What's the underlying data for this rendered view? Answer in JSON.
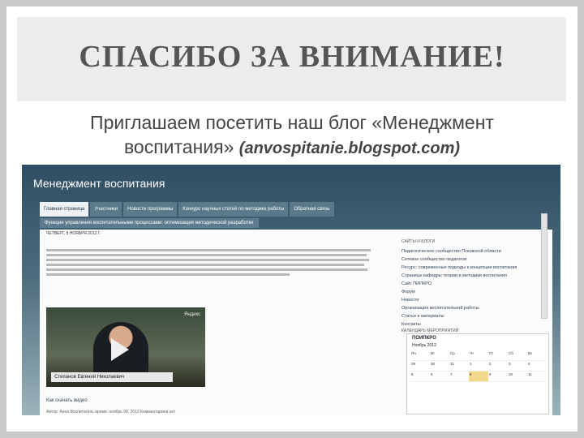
{
  "slide": {
    "title": "СПАСИБО ЗА ВНИМАНИЕ!",
    "subtitle_line1": "Приглашаем посетить наш блог «Менеджмент",
    "subtitle_line2": "воспитания»",
    "subtitle_url": "(anvospitanie.blogspot.com)"
  },
  "blog": {
    "name": "Менеджмент воспитания",
    "tabs": [
      "Главная страница",
      "Участники",
      "Новости программы",
      "Конкурс научных статей по методике работы",
      "Обратная связь"
    ],
    "tab_row2": "Функции управления воспитательными процессами: оптимизация методической разработки",
    "post": {
      "date": "ЧЕТВЕРГ, 8 НОЯБРЯ 2012 Г.",
      "title": "Ссылка на видеозапись",
      "video_caption": "Степанов Евгений Николаевич",
      "video_logo": "Яндекс",
      "link": "Как скачать видео",
      "footer": "Автор: Анна Воспитатель   время: ноябрь 08, 2012   Комментариев нет"
    },
    "sidebar": {
      "heading": "САЙТЫ И БЛОГИ",
      "items": [
        "Педагогическое сообщество Псковской области",
        "Сетевое сообщество педагогов",
        "Ресурс: современные подходы к концепции воспитания",
        "Страница кафедры теории и методики воспитания",
        "Сайт ПИПКРО",
        "Форум",
        "Новости",
        "Организация воспитательной работы",
        "Статьи и материалы",
        "Контакты"
      ],
      "calendar_heading": "КАЛЕНДАРЬ МЕРОПРИЯТИЙ",
      "calendar_brand": "ПОИПКРО",
      "calendar_month": "Ноябрь 2012",
      "calendar_days": [
        "Пн",
        "Вт",
        "Ср",
        "Чт",
        "Пт",
        "Сб",
        "Вс"
      ],
      "calendar_dates": [
        "29",
        "30",
        "31",
        "1",
        "2",
        "3",
        "4",
        "5",
        "6",
        "7",
        "8",
        "9",
        "10",
        "11"
      ]
    }
  }
}
